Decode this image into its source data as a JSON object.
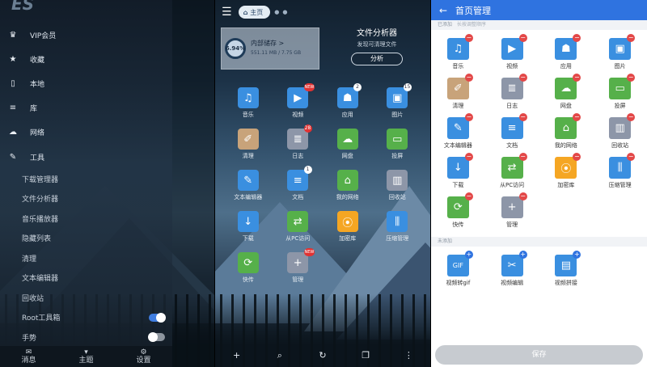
{
  "colors": {
    "primary": "#2f73e0",
    "tile_blue": "#3a8fe0",
    "tile_orange": "#f5a623",
    "tile_green": "#56b04a",
    "tile_gray": "#8d96a8",
    "badge_red": "#e23232"
  },
  "drawer": {
    "logo": "ES",
    "items": [
      {
        "icon": "crown-icon",
        "glyph": "♛",
        "label": "VIP会员"
      },
      {
        "icon": "star-icon",
        "glyph": "★",
        "label": "收藏"
      },
      {
        "icon": "phone-icon",
        "glyph": "▯",
        "label": "本地"
      },
      {
        "icon": "stack-icon",
        "glyph": "≡",
        "label": "库"
      },
      {
        "icon": "cloud-icon",
        "glyph": "☁",
        "label": "网络"
      },
      {
        "icon": "wrench-icon",
        "glyph": "✎",
        "label": "工具"
      }
    ],
    "tools": [
      "下载管理器",
      "文件分析器",
      "音乐播放器",
      "隐藏列表",
      "清理",
      "文本编辑器",
      "回收站",
      "Root工具箱",
      "手势"
    ],
    "bottom": [
      {
        "icon": "mail-icon",
        "glyph": "✉",
        "label": "消息"
      },
      {
        "icon": "shirt-icon",
        "glyph": "▾",
        "label": "主题"
      },
      {
        "icon": "gear-icon",
        "glyph": "⚙",
        "label": "设置"
      }
    ]
  },
  "home": {
    "tab": "主页",
    "storage": {
      "percent": "6.94%",
      "title": "内部储存 >",
      "size": "551.11 MB / 7.75 GB"
    },
    "analyzer": {
      "title": "文件分析器",
      "subtitle": "发现可清理文件",
      "button": "分析"
    },
    "grid": [
      {
        "name": "music",
        "label": "音乐",
        "glyph": "♫",
        "color": "#3a8fe0",
        "badge": ""
      },
      {
        "name": "video",
        "label": "视频",
        "glyph": "▶",
        "color": "#3a8fe0",
        "badge": "NEW"
      },
      {
        "name": "app",
        "label": "应用",
        "glyph": "☗",
        "color": "#3a8fe0",
        "badge": "2"
      },
      {
        "name": "image",
        "label": "图片",
        "glyph": "▣",
        "color": "#3a8fe0",
        "badge": "15"
      },
      {
        "name": "clean",
        "label": "清理",
        "glyph": "✐",
        "color": "#c8a37a",
        "badge": ""
      },
      {
        "name": "log",
        "label": "日志",
        "glyph": "≣",
        "color": "#8d96a8",
        "badge": "28"
      },
      {
        "name": "netdisk",
        "label": "网盘",
        "glyph": "☁",
        "color": "#56b04a",
        "badge": ""
      },
      {
        "name": "cast",
        "label": "投屏",
        "glyph": "▭",
        "color": "#56b04a",
        "badge": ""
      },
      {
        "name": "text-editor",
        "label": "文本编辑器",
        "glyph": "✎",
        "color": "#3a8fe0",
        "badge": ""
      },
      {
        "name": "document",
        "label": "文档",
        "glyph": "≡",
        "color": "#3a8fe0",
        "badge": "1"
      },
      {
        "name": "my-network",
        "label": "我的网络",
        "glyph": "⌂",
        "color": "#56b04a",
        "badge": ""
      },
      {
        "name": "recycle",
        "label": "回收站",
        "glyph": "▥",
        "color": "#8d96a8",
        "badge": ""
      },
      {
        "name": "download",
        "label": "下载",
        "glyph": "↓",
        "color": "#3a8fe0",
        "badge": ""
      },
      {
        "name": "pc-access",
        "label": "从PC访问",
        "glyph": "⇄",
        "color": "#56b04a",
        "badge": ""
      },
      {
        "name": "encrypt",
        "label": "加密库",
        "glyph": "⦿",
        "color": "#f5a623",
        "badge": ""
      },
      {
        "name": "zip",
        "label": "压缩管理",
        "glyph": "⫼",
        "color": "#3a8fe0",
        "badge": ""
      },
      {
        "name": "swipe",
        "label": "快传",
        "glyph": "⟳",
        "color": "#56b04a",
        "badge": ""
      },
      {
        "name": "manage",
        "label": "管理",
        "glyph": "+",
        "color": "#8d96a8",
        "badge": "NEW"
      }
    ],
    "bottom": [
      {
        "icon": "plus-icon",
        "glyph": "+",
        "label": "新建"
      },
      {
        "icon": "search-icon",
        "glyph": "⌕",
        "label": "搜索"
      },
      {
        "icon": "refresh-icon",
        "glyph": "↻",
        "label": "刷新"
      },
      {
        "icon": "windows-icon",
        "glyph": "❐",
        "label": "窗口"
      },
      {
        "icon": "more-icon",
        "glyph": "⋮",
        "label": "更多"
      }
    ]
  },
  "manager": {
    "title": "首页管理",
    "added_label": "已添加",
    "added_hint": "长按调整顺序",
    "not_added_label": "未添加",
    "added": [
      {
        "name": "music",
        "label": "音乐",
        "glyph": "♫",
        "color": "#3a8fe0"
      },
      {
        "name": "video",
        "label": "视频",
        "glyph": "▶",
        "color": "#3a8fe0"
      },
      {
        "name": "app",
        "label": "应用",
        "glyph": "☗",
        "color": "#3a8fe0"
      },
      {
        "name": "image",
        "label": "图片",
        "glyph": "▣",
        "color": "#3a8fe0"
      },
      {
        "name": "clean",
        "label": "清理",
        "glyph": "✐",
        "color": "#c8a37a"
      },
      {
        "name": "log",
        "label": "日志",
        "glyph": "≣",
        "color": "#8d96a8"
      },
      {
        "name": "netdisk",
        "label": "网盘",
        "glyph": "☁",
        "color": "#56b04a"
      },
      {
        "name": "cast",
        "label": "投屏",
        "glyph": "▭",
        "color": "#56b04a"
      },
      {
        "name": "text-editor",
        "label": "文本编辑器",
        "glyph": "✎",
        "color": "#3a8fe0"
      },
      {
        "name": "document",
        "label": "文档",
        "glyph": "≡",
        "color": "#3a8fe0"
      },
      {
        "name": "my-network",
        "label": "我的网络",
        "glyph": "⌂",
        "color": "#56b04a"
      },
      {
        "name": "recycle",
        "label": "回收站",
        "glyph": "▥",
        "color": "#8d96a8"
      },
      {
        "name": "download",
        "label": "下载",
        "glyph": "↓",
        "color": "#3a8fe0"
      },
      {
        "name": "pc-access",
        "label": "从PC访问",
        "glyph": "⇄",
        "color": "#56b04a"
      },
      {
        "name": "encrypt",
        "label": "加密库",
        "glyph": "⦿",
        "color": "#f5a623"
      },
      {
        "name": "zip",
        "label": "压缩管理",
        "glyph": "⫼",
        "color": "#3a8fe0"
      },
      {
        "name": "swipe",
        "label": "快传",
        "glyph": "⟳",
        "color": "#56b04a"
      },
      {
        "name": "manage",
        "label": "管理",
        "glyph": "+",
        "color": "#8d96a8"
      }
    ],
    "not_added": [
      {
        "name": "video-to-gif",
        "label": "视频转gif",
        "glyph": "GIF",
        "color": "#3a8fe0"
      },
      {
        "name": "video-edit",
        "label": "视频编辑",
        "glyph": "✂",
        "color": "#3a8fe0"
      },
      {
        "name": "video-merge",
        "label": "视频拼接",
        "glyph": "▤",
        "color": "#3a8fe0"
      }
    ],
    "save": "保存"
  }
}
